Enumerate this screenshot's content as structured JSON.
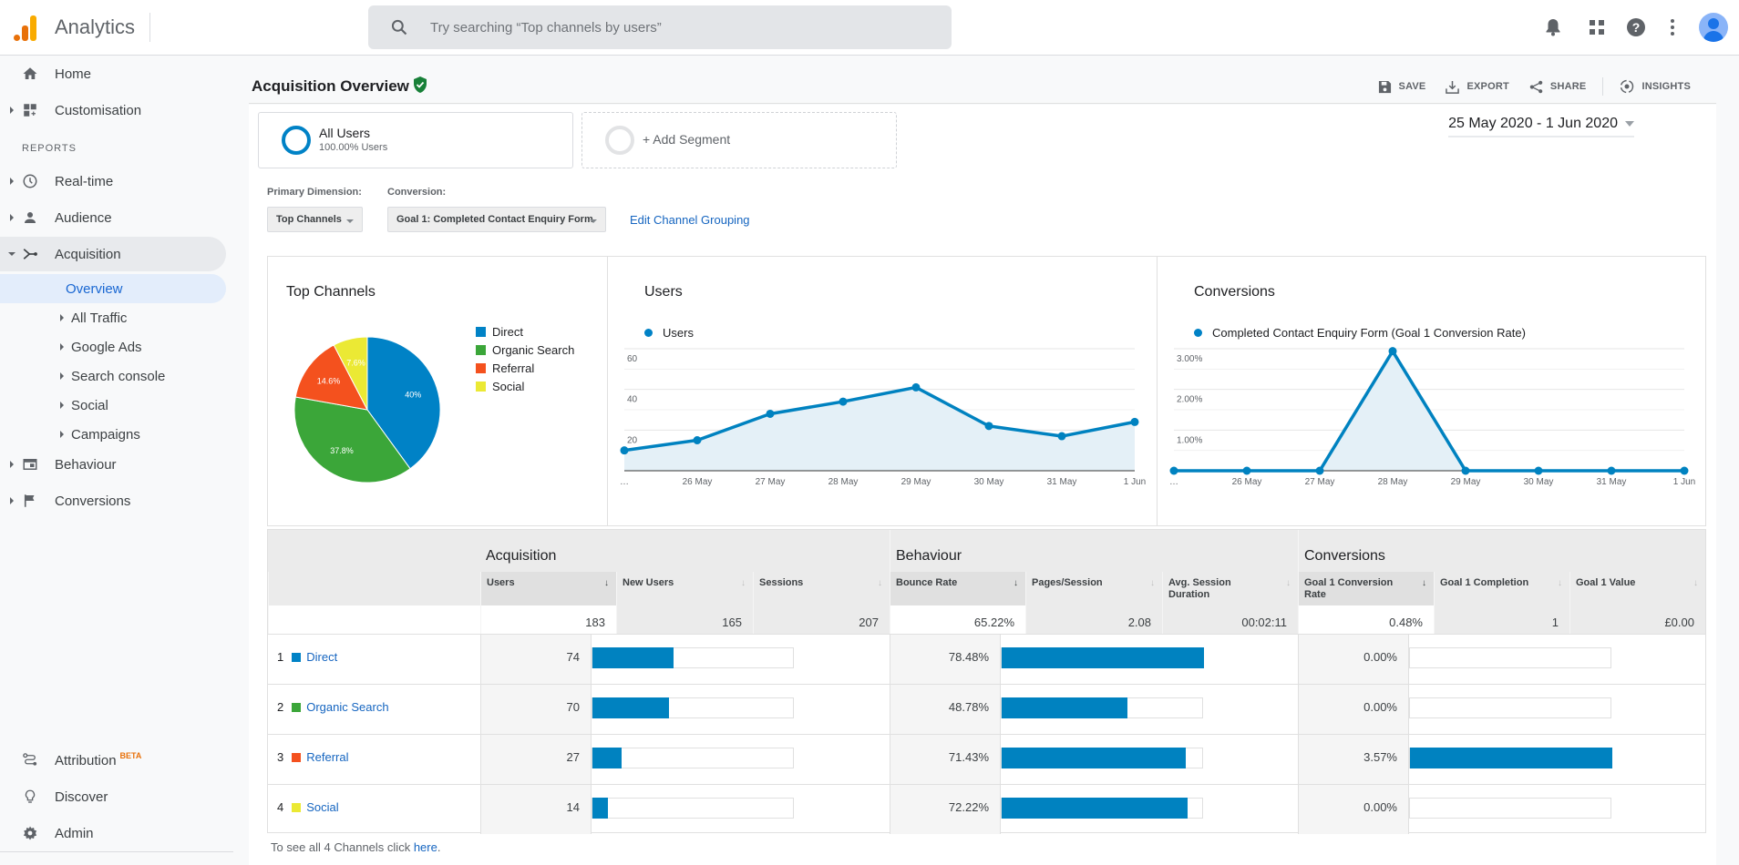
{
  "app": {
    "title": "Analytics",
    "search_placeholder": "Try searching “Top channels by users”"
  },
  "topbar_icons": [
    "bell-icon",
    "apps-grid-icon",
    "help-icon",
    "more-vert-icon",
    "avatar"
  ],
  "sidebar": {
    "items_top": [
      {
        "label": "Home",
        "icon": "home-icon"
      },
      {
        "label": "Customisation",
        "icon": "dashboard-icon"
      }
    ],
    "reports_label": "REPORTS",
    "reports": [
      {
        "label": "Real-time",
        "icon": "clock-icon"
      },
      {
        "label": "Audience",
        "icon": "person-icon"
      },
      {
        "label": "Acquisition",
        "icon": "acquisition-icon",
        "expanded": true
      },
      {
        "label": "Behaviour",
        "icon": "behaviour-icon"
      },
      {
        "label": "Conversions",
        "icon": "flag-icon"
      }
    ],
    "acquisition_sub": [
      {
        "label": "Overview",
        "selected": true
      },
      {
        "label": "All Traffic"
      },
      {
        "label": "Google Ads"
      },
      {
        "label": "Search console"
      },
      {
        "label": "Social"
      },
      {
        "label": "Campaigns"
      }
    ],
    "bottom": [
      {
        "label": "Attribution",
        "badge": "BETA",
        "icon": "attribution-icon"
      },
      {
        "label": "Discover",
        "icon": "lightbulb-icon"
      },
      {
        "label": "Admin",
        "icon": "gear-icon"
      }
    ]
  },
  "header": {
    "title": "Acquisition Overview",
    "actions": {
      "save": "SAVE",
      "export": "EXPORT",
      "share": "SHARE",
      "insights": "INSIGHTS"
    }
  },
  "segments": {
    "all_users": {
      "title": "All Users",
      "subtitle": "100.00% Users"
    },
    "add": "+ Add Segment"
  },
  "date_range": "25 May 2020 - 1 Jun 2020",
  "controls": {
    "primary_dimension_label": "Primary Dimension:",
    "primary_dimension_value": "Top Channels",
    "conversion_label": "Conversion:",
    "conversion_value": "Goal 1: Completed Contact Enquiry Form",
    "edit_link": "Edit Channel Grouping"
  },
  "colors": {
    "direct": "#0082c6",
    "organic": "#3ba639",
    "referral": "#f4511e",
    "social": "#ebe934",
    "line": "#0082c0",
    "area": "#e4f0f7",
    "link": "#1565c0"
  },
  "chart_data": [
    {
      "type": "pie",
      "title": "Top Channels",
      "categories": [
        "Direct",
        "Organic Search",
        "Referral",
        "Social"
      ],
      "values": [
        40.0,
        37.8,
        14.6,
        7.6
      ],
      "labels": [
        "40%",
        "37.8%",
        "14.6%",
        "7.6%"
      ],
      "legend": "right"
    },
    {
      "type": "area",
      "title": "Users",
      "legend_label": "Users",
      "x": [
        "…",
        "26 May",
        "27 May",
        "28 May",
        "29 May",
        "30 May",
        "31 May",
        "1 Jun"
      ],
      "values": [
        10,
        15,
        28,
        34,
        41,
        22,
        17,
        24
      ],
      "yticks": [
        "20",
        "40",
        "60"
      ],
      "ylim": [
        0,
        60
      ],
      "grid": true
    },
    {
      "type": "area",
      "title": "Conversions",
      "legend_label": "Completed Contact Enquiry Form (Goal 1 Conversion Rate)",
      "x": [
        "…",
        "26 May",
        "27 May",
        "28 May",
        "29 May",
        "30 May",
        "31 May",
        "1 Jun"
      ],
      "values": [
        0,
        0,
        0,
        2.94,
        0,
        0,
        0,
        0
      ],
      "yticks": [
        "1.00%",
        "2.00%",
        "3.00%"
      ],
      "ylim": [
        0,
        3
      ],
      "grid": true
    }
  ],
  "table": {
    "groups": [
      "Acquisition",
      "Behaviour",
      "Conversions"
    ],
    "columns": [
      "Users",
      "New Users",
      "Sessions",
      "Bounce Rate",
      "Pages/Session",
      "Avg. Session Duration",
      "Goal 1 Conversion Rate",
      "Goal 1 Completion",
      "Goal 1 Value"
    ],
    "sort_glyph": "↓",
    "totals": [
      "183",
      "165",
      "207",
      "65.22%",
      "2.08",
      "00:02:11",
      "0.48%",
      "1",
      "£0.00"
    ],
    "rows": [
      {
        "rank": "1",
        "channel": "Direct",
        "users": "74",
        "users_share": 0.4,
        "bounce": "78.48%",
        "bounce_share": 1.0,
        "conv": "0.00%",
        "conv_share": 0.0
      },
      {
        "rank": "2",
        "channel": "Organic Search",
        "users": "70",
        "users_share": 0.378,
        "bounce": "48.78%",
        "bounce_share": 0.622,
        "conv": "0.00%",
        "conv_share": 0.0
      },
      {
        "rank": "3",
        "channel": "Referral",
        "users": "27",
        "users_share": 0.146,
        "bounce": "71.43%",
        "bounce_share": 0.91,
        "conv": "3.57%",
        "conv_share": 1.0
      },
      {
        "rank": "4",
        "channel": "Social",
        "users": "14",
        "users_share": 0.076,
        "bounce": "72.22%",
        "bounce_share": 0.92,
        "conv": "0.00%",
        "conv_share": 0.0
      }
    ],
    "footer_prefix": "To see all 4 Channels click ",
    "footer_link": "here",
    "footer_suffix": "."
  }
}
